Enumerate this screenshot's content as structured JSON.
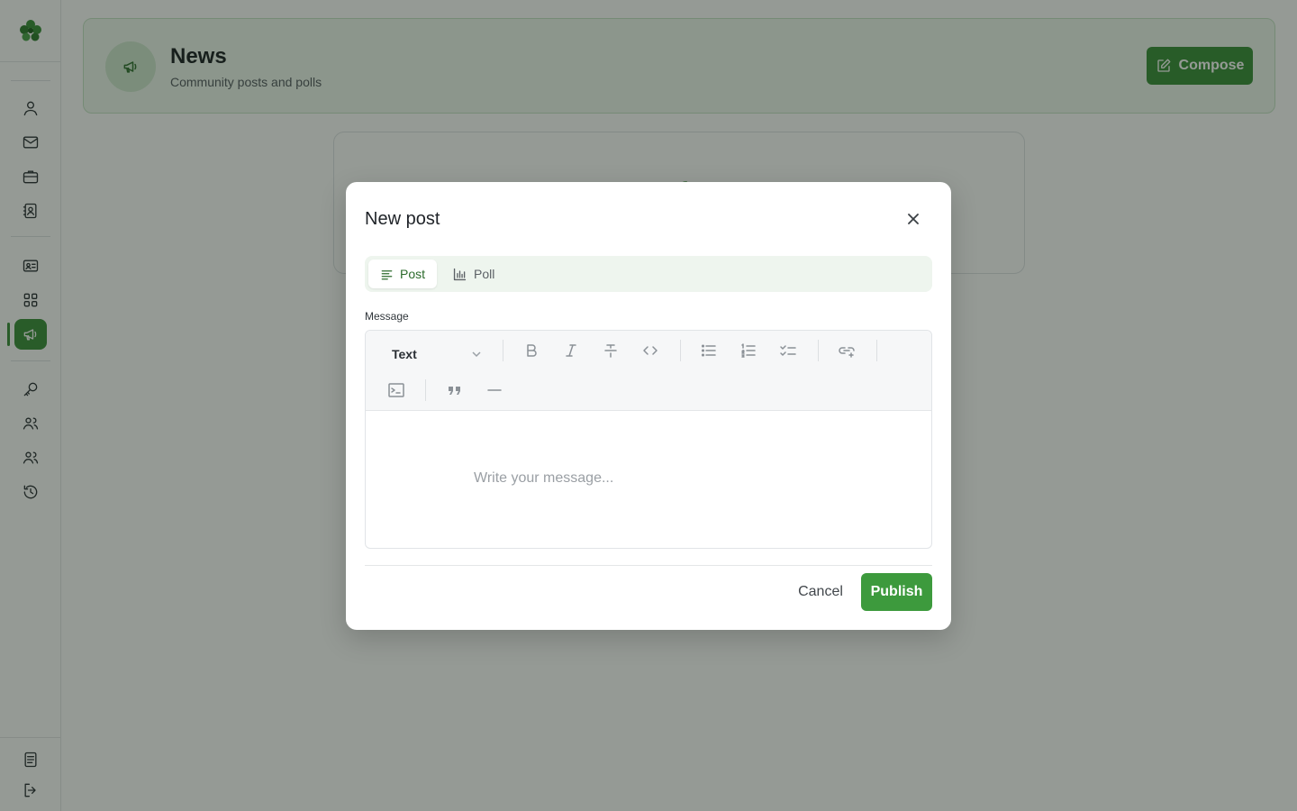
{
  "sidebar": {
    "logo": "leaf-logo-icon",
    "items": [
      {
        "name": "user-icon"
      },
      {
        "name": "mail-icon"
      },
      {
        "name": "briefcase-icon"
      },
      {
        "name": "contacts-icon"
      },
      {
        "name": "id-card-icon"
      },
      {
        "name": "apps-grid-icon"
      },
      {
        "name": "megaphone-icon",
        "active": true
      },
      {
        "name": "key-icon"
      },
      {
        "name": "team-icon"
      },
      {
        "name": "group-icon"
      },
      {
        "name": "history-icon"
      }
    ],
    "bottom": [
      {
        "name": "document-icon"
      },
      {
        "name": "logout-icon"
      }
    ]
  },
  "header": {
    "title": "News",
    "subtitle": "Community posts and polls",
    "compose_label": "Compose",
    "icon": "megaphone-icon"
  },
  "modal": {
    "title": "New post",
    "tabs": [
      {
        "label": "Post",
        "icon": "text-lines-icon",
        "selected": true
      },
      {
        "label": "Poll",
        "icon": "bar-chart-icon",
        "selected": false
      }
    ],
    "message_label": "Message",
    "editor": {
      "block_type": "Text",
      "placeholder": "Write your message..."
    },
    "cancel_label": "Cancel",
    "publish_label": "Publish"
  },
  "colors": {
    "accent": "#3b8f3b",
    "overlay": "rgba(20,30,20,0.45)"
  }
}
